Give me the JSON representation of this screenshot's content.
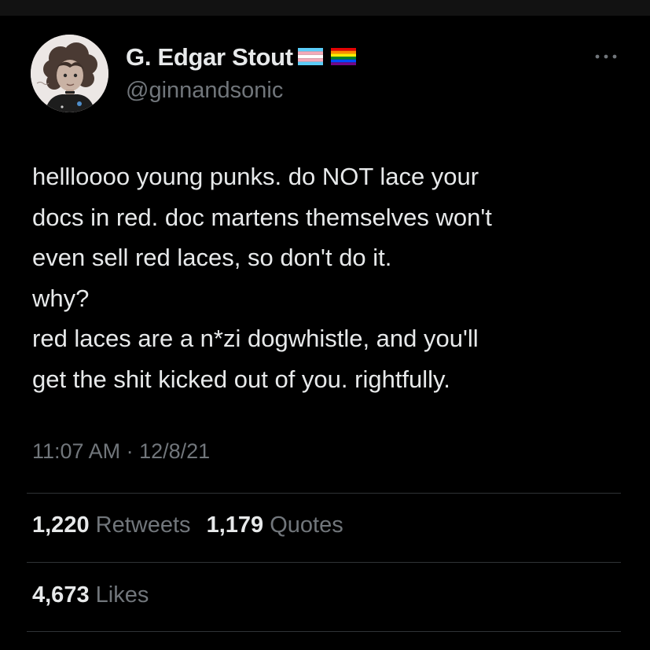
{
  "author": {
    "display_name": "G. Edgar Stout",
    "handle": "@ginnandsonic",
    "flags": [
      "transgender-flag",
      "rainbow-pride-flag"
    ]
  },
  "tweet": {
    "lines": [
      "hellloooo young punks. do NOT lace your",
      "docs in red. doc martens themselves won't",
      "even sell red laces, so don't do it.",
      "why?",
      "red laces are a n*zi dogwhistle, and you'll",
      "get the shit kicked out of you. rightfully."
    ],
    "timestamp": "11:07 AM · 12/8/21"
  },
  "stats": {
    "retweets": {
      "count": "1,220",
      "label": "Retweets"
    },
    "quotes": {
      "count": "1,179",
      "label": "Quotes"
    },
    "likes": {
      "count": "4,673",
      "label": "Likes"
    }
  },
  "icons": {
    "more": "more-horizontal-icon"
  },
  "colors": {
    "background": "#000000",
    "primary_text": "#e7e9ea",
    "secondary_text": "#71767b",
    "divider": "#2f3336"
  }
}
